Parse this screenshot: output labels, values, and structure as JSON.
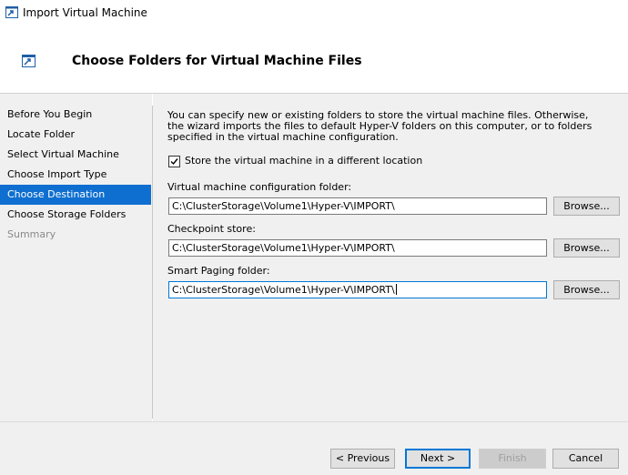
{
  "window": {
    "title": "Import Virtual Machine",
    "app_icon": "import-vm-icon"
  },
  "header": {
    "title": "Choose Folders for Virtual Machine Files",
    "icon": "import-vm-icon"
  },
  "sidebar": {
    "items": [
      {
        "label": "Before You Begin"
      },
      {
        "label": "Locate Folder"
      },
      {
        "label": "Select Virtual Machine"
      },
      {
        "label": "Choose Import Type"
      },
      {
        "label": "Choose Destination",
        "active": true
      },
      {
        "label": "Choose Storage Folders"
      },
      {
        "label": "Summary",
        "disabled": true
      }
    ]
  },
  "main": {
    "description": "You can specify new or existing folders to store the virtual machine files. Otherwise, the wizard imports the files to default Hyper-V folders on this computer, or to folders specified in the virtual machine configuration.",
    "checkbox": {
      "label": "Store the virtual machine in a different location",
      "checked": true
    },
    "fields": [
      {
        "label": "Virtual machine configuration folder:",
        "value": "C:\\ClusterStorage\\Volume1\\Hyper-V\\IMPORT\\",
        "button": "Browse..."
      },
      {
        "label": "Checkpoint store:",
        "value": "C:\\ClusterStorage\\Volume1\\Hyper-V\\IMPORT\\",
        "button": "Browse..."
      },
      {
        "label": "Smart Paging folder:",
        "value": "C:\\ClusterStorage\\Volume1\\Hyper-V\\IMPORT\\",
        "button": "Browse..."
      }
    ]
  },
  "footer": {
    "previous": "< Previous",
    "next": "Next >",
    "finish": "Finish",
    "cancel": "Cancel"
  },
  "colors": {
    "accent": "#0f6fd0",
    "focus_border": "#0078d7",
    "panel_bg": "#f0f0f0"
  }
}
